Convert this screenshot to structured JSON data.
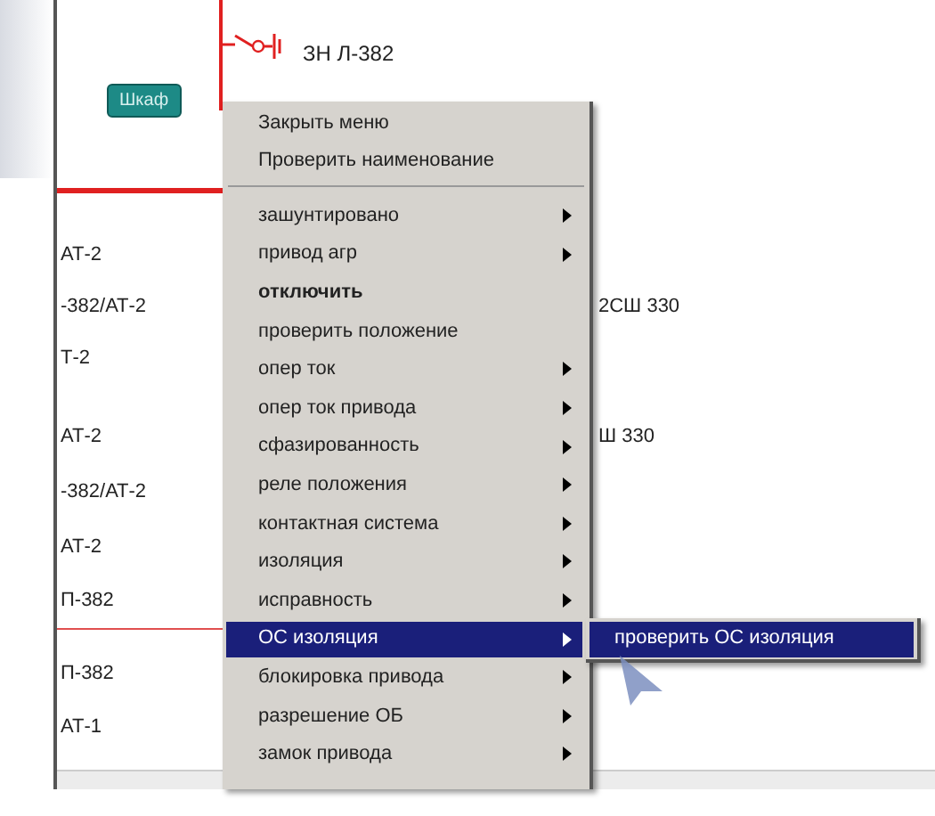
{
  "diagram": {
    "top_label": "ЗН Л-382",
    "cabinet_button": "Шкаф",
    "left_labels": [
      "АТ-2",
      "-382/АТ-2",
      "Т-2",
      "АТ-2",
      "-382/АТ-2",
      "АТ-2",
      "П-382",
      "П-382",
      "АТ-1"
    ],
    "right_labels": [
      "2СШ 330",
      "Ш 330"
    ]
  },
  "context_menu": {
    "top_items": [
      {
        "label": "Закрыть меню"
      },
      {
        "label": "Проверить наименование"
      }
    ],
    "items": [
      {
        "label": "зашунтировано",
        "submenu": true,
        "bold": false,
        "selected": false
      },
      {
        "label": "привод агр",
        "submenu": true,
        "bold": false,
        "selected": false
      },
      {
        "label": "отключить",
        "submenu": false,
        "bold": true,
        "selected": false
      },
      {
        "label": "проверить положение",
        "submenu": false,
        "bold": false,
        "selected": false
      },
      {
        "label": "опер ток",
        "submenu": true,
        "bold": false,
        "selected": false
      },
      {
        "label": "опер ток привода",
        "submenu": true,
        "bold": false,
        "selected": false
      },
      {
        "label": "сфазированность",
        "submenu": true,
        "bold": false,
        "selected": false
      },
      {
        "label": "реле положения",
        "submenu": true,
        "bold": false,
        "selected": false
      },
      {
        "label": "контактная система",
        "submenu": true,
        "bold": false,
        "selected": false
      },
      {
        "label": "изоляция",
        "submenu": true,
        "bold": false,
        "selected": false
      },
      {
        "label": "исправность",
        "submenu": true,
        "bold": false,
        "selected": false
      },
      {
        "label": "ОС изоляция",
        "submenu": true,
        "bold": false,
        "selected": true
      },
      {
        "label": "блокировка привода",
        "submenu": true,
        "bold": false,
        "selected": false
      },
      {
        "label": "разрешение ОБ",
        "submenu": true,
        "bold": false,
        "selected": false
      },
      {
        "label": "замок привода",
        "submenu": true,
        "bold": false,
        "selected": false
      }
    ]
  },
  "submenu": {
    "items": [
      {
        "label": "проверить ОС изоляция",
        "selected": true
      }
    ]
  }
}
